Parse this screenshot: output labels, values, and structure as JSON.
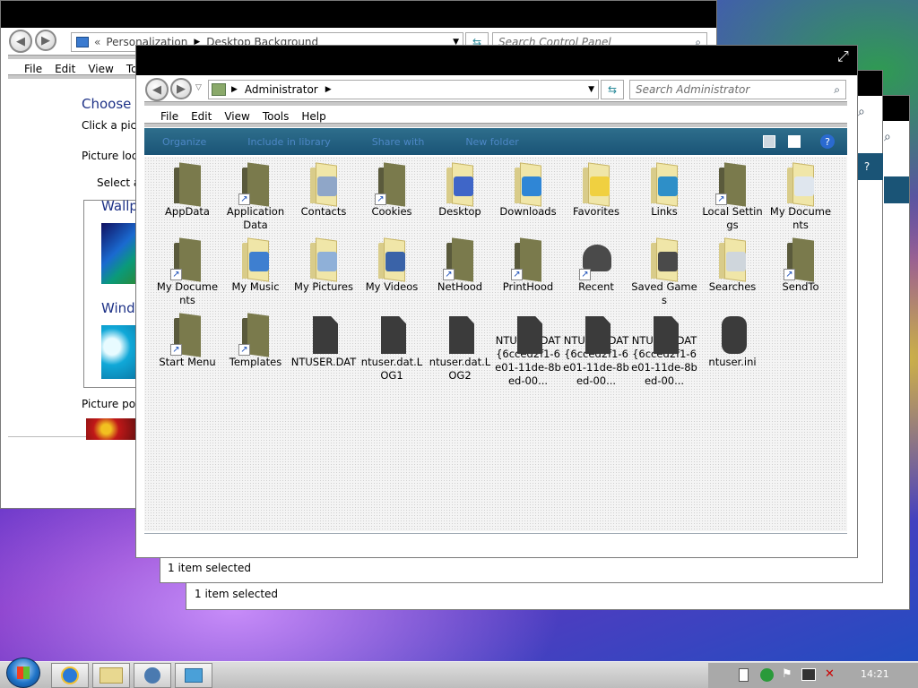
{
  "control_panel": {
    "breadcrumb_chevrons": "«",
    "breadcrumb": [
      "Personalization",
      "Desktop Background"
    ],
    "search_placeholder": "Search Control Panel",
    "menu": [
      "File",
      "Edit",
      "View",
      "To"
    ],
    "heading": "Choose y",
    "subtext": "Click a pictu",
    "picture_location_label": "Picture loca",
    "select_all_label": "Select all",
    "group_wallpapers": "Wallp",
    "group_windows": "Windo",
    "picture_position_label": "Picture posi"
  },
  "explorer": {
    "address": [
      "Administrator"
    ],
    "search_placeholder": "Search Administrator",
    "menu": [
      "File",
      "Edit",
      "View",
      "Tools",
      "Help"
    ],
    "commands": [
      "Organize",
      "Include in library",
      "Share with",
      "New folder"
    ],
    "items": [
      {
        "label": "AppData",
        "kind": "folder-dark",
        "shortcut": false
      },
      {
        "label": "Application Data",
        "kind": "folder-dark",
        "shortcut": true
      },
      {
        "label": "Contacts",
        "kind": "folder-light",
        "overlay": "#8fa6c8"
      },
      {
        "label": "Cookies",
        "kind": "folder-dark",
        "shortcut": true
      },
      {
        "label": "Desktop",
        "kind": "folder-light",
        "overlay": "#3f66c8"
      },
      {
        "label": "Downloads",
        "kind": "folder-light",
        "overlay": "#2f86d6"
      },
      {
        "label": "Favorites",
        "kind": "folder-light",
        "overlay": "#f0d040"
      },
      {
        "label": "Links",
        "kind": "folder-light",
        "overlay": "#2e8fc8"
      },
      {
        "label": "Local Settings",
        "kind": "folder-dark",
        "shortcut": true
      },
      {
        "label": "My Documents",
        "kind": "folder-light",
        "overlay": "#dfe6ee"
      },
      {
        "label": "My Documents",
        "kind": "folder-dark",
        "shortcut": true
      },
      {
        "label": "My Music",
        "kind": "folder-light",
        "overlay": "#3e7fd0"
      },
      {
        "label": "My Pictures",
        "kind": "folder-light",
        "overlay": "#8fb0d8"
      },
      {
        "label": "My Videos",
        "kind": "folder-light",
        "overlay": "#3a63a8"
      },
      {
        "label": "NetHood",
        "kind": "folder-dark",
        "shortcut": true
      },
      {
        "label": "PrintHood",
        "kind": "folder-dark",
        "shortcut": true
      },
      {
        "label": "Recent",
        "kind": "recent",
        "shortcut": true
      },
      {
        "label": "Saved Games",
        "kind": "folder-light",
        "overlay": "#4a4a4a"
      },
      {
        "label": "Searches",
        "kind": "folder-light",
        "overlay": "#cfd6dc"
      },
      {
        "label": "SendTo",
        "kind": "folder-dark",
        "shortcut": true
      },
      {
        "label": "Start Menu",
        "kind": "folder-dark",
        "shortcut": true
      },
      {
        "label": "Templates",
        "kind": "folder-dark",
        "shortcut": true
      },
      {
        "label": "NTUSER.DAT",
        "kind": "doc"
      },
      {
        "label": "ntuser.dat.LOG1",
        "kind": "doc"
      },
      {
        "label": "ntuser.dat.LOG2",
        "kind": "doc"
      },
      {
        "label": "NTUSER.DAT{6cced2f1-6e01-11de-8bed-00...",
        "kind": "doc"
      },
      {
        "label": "NTUSER.DAT{6cced2f1-6e01-11de-8bed-00...",
        "kind": "doc"
      },
      {
        "label": "NTUSER.DAT{6cced2f1-6e01-11de-8bed-00...",
        "kind": "doc"
      },
      {
        "label": "ntuser.ini",
        "kind": "ini"
      }
    ],
    "status": "1 item selected"
  },
  "behind_window": {
    "status": "1 item selected"
  },
  "taskbar": {
    "clock": "14:21"
  }
}
